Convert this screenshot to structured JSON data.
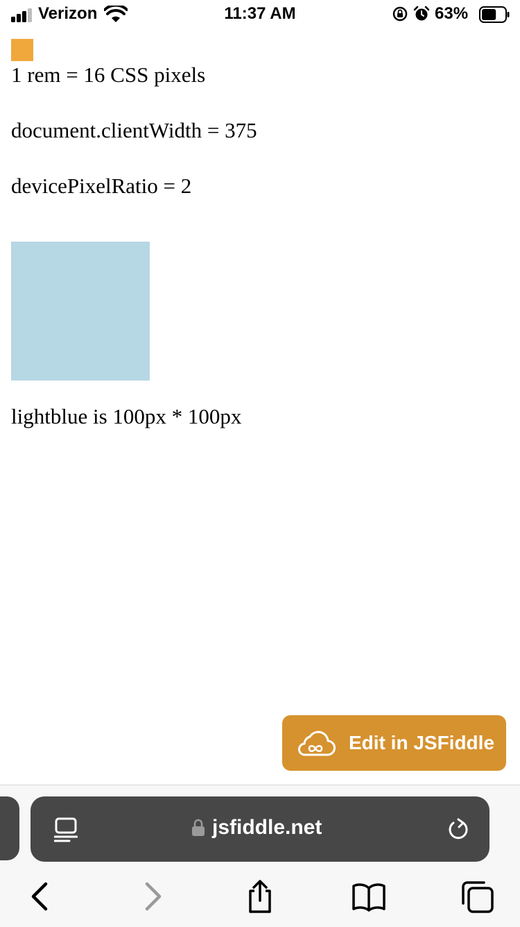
{
  "status_bar": {
    "carrier": "Verizon",
    "time": "11:37 AM",
    "battery_percent": "63%",
    "battery_level": 0.63,
    "signal_bars": 3,
    "icons": [
      "signal-icon",
      "wifi-icon",
      "orientation-lock-icon",
      "alarm-icon",
      "battery-icon"
    ]
  },
  "page": {
    "line_rem": "1 rem = 16 CSS pixels",
    "line_client_width": "document.clientWidth = 375",
    "line_device_pixel_ratio": "devicePixelRatio = 2",
    "line_lightblue": "lightblue is 100px * 100px",
    "colors": {
      "orange_square": "#f0a83c",
      "lightblue_box": "#b6d7e4"
    }
  },
  "jsfiddle_button": {
    "label": "Edit in JSFiddle",
    "icon": "cloud-infinity-icon",
    "color": "#d6922e"
  },
  "safari": {
    "url": "jsfiddle.net",
    "reader_icon": "reader-mode-icon",
    "lock_icon": "padlock-icon",
    "reload_icon": "reload-icon",
    "toolbar": [
      "back-icon",
      "forward-icon",
      "share-icon",
      "bookmarks-icon",
      "tabs-icon"
    ]
  }
}
